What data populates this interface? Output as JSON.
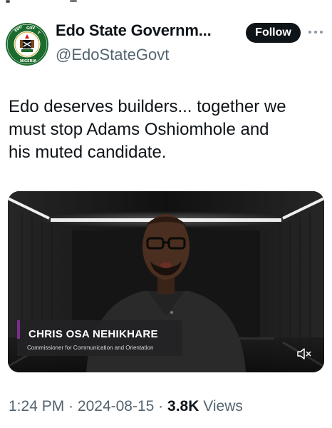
{
  "account": {
    "display_name": "Edo State Governm...",
    "handle": "@EdoStateGovt",
    "avatar_seal_text": "EDO STATE GOVERNMENT · NIGERIA"
  },
  "actions": {
    "follow_label": "Follow",
    "more_icon": "more-horizontal-icon"
  },
  "tweet": {
    "text": "Edo deserves builders... together we\nmust stop Adams Oshiomhole and\nhis muted candidate."
  },
  "video": {
    "lower_third_name": "CHRIS OSA NEHIKHARE",
    "lower_third_role": "Commissioner for Communication and Orientation",
    "mute_icon": "speaker-muted-icon",
    "accent_color": "#7a2e8c"
  },
  "meta": {
    "time": "1:24 PM",
    "separator": "·",
    "date": "2024-08-15",
    "views_count": "3.8K",
    "views_label": "Views"
  },
  "colors": {
    "text_primary": "#0f1419",
    "text_secondary": "#536471",
    "follow_bg": "#0f1419"
  }
}
